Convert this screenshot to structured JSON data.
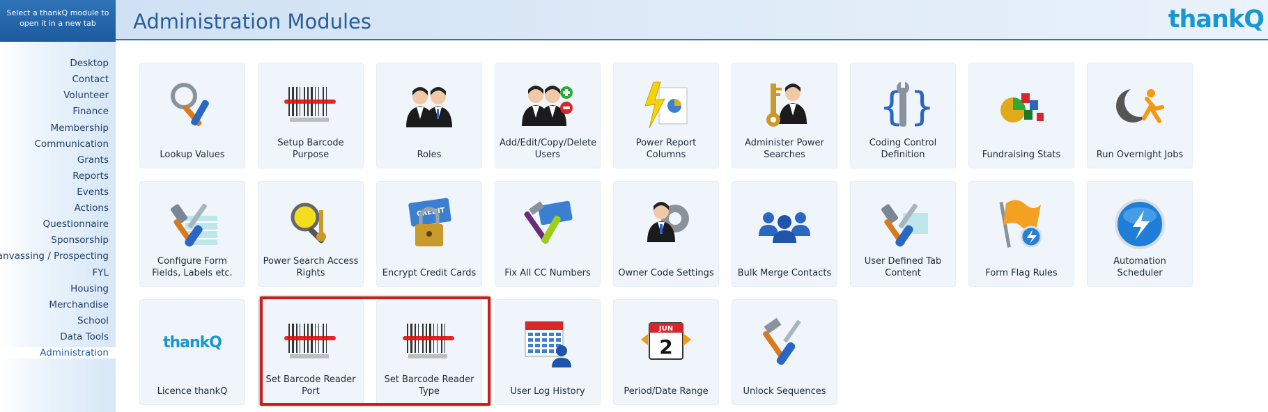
{
  "sidebar": {
    "hint": "Select a thankQ module to open it in a new tab",
    "items": [
      {
        "label": "Desktop"
      },
      {
        "label": "Contact"
      },
      {
        "label": "Volunteer"
      },
      {
        "label": "Finance"
      },
      {
        "label": "Membership"
      },
      {
        "label": "Communication"
      },
      {
        "label": "Grants"
      },
      {
        "label": "Reports"
      },
      {
        "label": "Events"
      },
      {
        "label": "Actions"
      },
      {
        "label": "Questionnaire"
      },
      {
        "label": "Sponsorship"
      },
      {
        "label": "Canvassing / Prospecting"
      },
      {
        "label": "FYL"
      },
      {
        "label": "Housing"
      },
      {
        "label": "Merchandise"
      },
      {
        "label": "School"
      },
      {
        "label": "Data Tools"
      },
      {
        "label": "Administration"
      }
    ],
    "active": "Administration"
  },
  "header": {
    "title": "Administration Modules",
    "logo": "thankQ"
  },
  "modules": [
    {
      "label": "Lookup Values",
      "icon": "tools-magnifier-icon"
    },
    {
      "label": "Setup Barcode Purpose",
      "icon": "barcode-icon"
    },
    {
      "label": "Roles",
      "icon": "users-pair-icon"
    },
    {
      "label": "Add/Edit/Copy/Delete Users",
      "icon": "users-add-remove-icon"
    },
    {
      "label": "Power Report Columns",
      "icon": "power-report-icon"
    },
    {
      "label": "Administer Power Searches",
      "icon": "key-user-icon"
    },
    {
      "label": "Coding Control Definition",
      "icon": "code-wrench-icon"
    },
    {
      "label": "Fundraising Stats",
      "icon": "stats-chart-icon"
    },
    {
      "label": "Run Overnight Jobs",
      "icon": "moon-runner-icon"
    },
    {
      "label": "Configure Form Fields, Labels etc.",
      "icon": "tools-form-icon"
    },
    {
      "label": "Power Search Access Rights",
      "icon": "search-key-icon"
    },
    {
      "label": "Encrypt Credit Cards",
      "icon": "credit-lock-icon"
    },
    {
      "label": "Fix All CC Numbers",
      "icon": "credit-tools-icon"
    },
    {
      "label": "Owner Code Settings",
      "icon": "user-gear-icon"
    },
    {
      "label": "Bulk Merge Contacts",
      "icon": "group-merge-icon"
    },
    {
      "label": "User Defined Tab Content",
      "icon": "tools-tab-icon"
    },
    {
      "label": "Form Flag Rules",
      "icon": "flag-icon"
    },
    {
      "label": "Automation Scheduler",
      "icon": "lightning-globe-icon"
    },
    {
      "label": "Licence thankQ",
      "icon": "thankq-logo-icon",
      "logo_text": "thankQ"
    },
    {
      "label": "Set Barcode Reader Port",
      "icon": "barcode-icon"
    },
    {
      "label": "Set Barcode Reader Type",
      "icon": "barcode-icon"
    },
    {
      "label": "User Log History",
      "icon": "calendar-user-icon"
    },
    {
      "label": "Period/Date Range",
      "icon": "calendar-date-icon",
      "month": "JUN",
      "day": "2"
    },
    {
      "label": "Unlock Sequences",
      "icon": "hammer-screwdriver-icon"
    }
  ],
  "colors": {
    "accent": "#2b75b7",
    "title": "#2a5d9a",
    "logo": "#1a97d1",
    "highlight": "#c81e1e",
    "tile_bg": "#eff5fb"
  }
}
